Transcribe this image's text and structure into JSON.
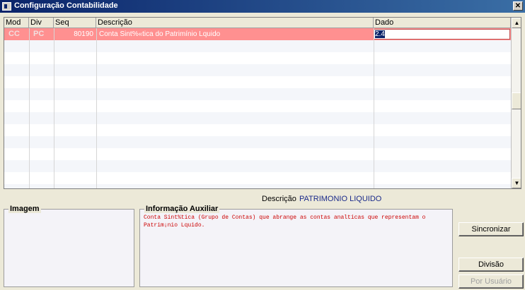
{
  "window": {
    "title": "Configuração Contabilidade",
    "close_glyph": "✕"
  },
  "grid": {
    "columns": [
      "Mod",
      "Div",
      "Seq",
      "Descrição",
      "Dado"
    ],
    "rows": [
      {
        "mod": "CC",
        "div": "PC",
        "seq": "80190",
        "descricao": "Conta Sint%«tica do Patrimínio Lquido",
        "dado": "2.4"
      }
    ]
  },
  "scrollbar": {
    "up_glyph": "▲",
    "down_glyph": "▼"
  },
  "description": {
    "label": "Descrição",
    "value": "PATRIMONIO LIQUIDO"
  },
  "imagem": {
    "legend": "Imagem"
  },
  "informacao_auxiliar": {
    "legend": "Informação Auxiliar",
    "text": "Conta Sint%tica (Grupo de Contas) que abrange as contas analticas que representam o\nPatrim¡nio Lquido."
  },
  "buttons": {
    "sincronizar": "Sincronizar",
    "divisao": "Divisão",
    "por_usuario": "Por Usuário"
  },
  "colors": {
    "selected_row": "#ff9090",
    "title_bar": "#0a246a",
    "aux_text": "#cc0000",
    "desc_value": "#1a2a8a"
  }
}
